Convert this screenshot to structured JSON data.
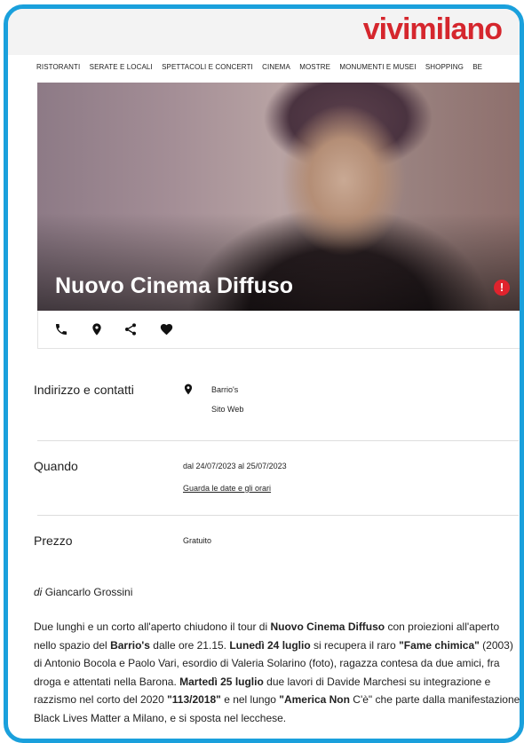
{
  "site": {
    "logo": "vivimilano",
    "accent": "#d5262d",
    "frame_color": "#1aa0dc"
  },
  "nav": {
    "items": [
      "RISTORANTI",
      "SERATE E LOCALI",
      "SPETTACOLI E CONCERTI",
      "CINEMA",
      "MOSTRE",
      "MONUMENTI E MUSEI",
      "SHOPPING",
      "BE"
    ]
  },
  "hero": {
    "title": "Nuovo Cinema Diffuso",
    "alert_symbol": "!"
  },
  "actions": [
    {
      "icon": "phone-icon"
    },
    {
      "icon": "location-pin-icon"
    },
    {
      "icon": "share-icon"
    },
    {
      "icon": "heart-icon"
    }
  ],
  "details": {
    "address": {
      "label": "Indirizzo e contatti",
      "venue": "Barrio's",
      "website": "Sito Web"
    },
    "when": {
      "label": "Quando",
      "range": "dal 24/07/2023 al 25/07/2023",
      "link": "Guarda le date e gli orari"
    },
    "price": {
      "label": "Prezzo",
      "value": "Gratuito"
    }
  },
  "article": {
    "author_prefix": "di",
    "author": "Giancarlo Grossini",
    "segments": [
      {
        "text": "Due lunghi e un corto all'aperto chiudono il tour di ",
        "bold": false
      },
      {
        "text": "Nuovo Cinema Diffuso",
        "bold": true
      },
      {
        "text": " con proiezioni all'aperto nello spazio del ",
        "bold": false
      },
      {
        "text": "Barrio's",
        "bold": true
      },
      {
        "text": " dalle ore 21.15. ",
        "bold": false
      },
      {
        "text": "Lunedì 24 luglio",
        "bold": true
      },
      {
        "text": " si recupera il raro ",
        "bold": false
      },
      {
        "text": "\"Fame chimica\"",
        "bold": true
      },
      {
        "text": " (2003) di Antonio Bocola e Paolo Vari, esordio di Valeria Solarino (foto), ragazza contesa da due amici, fra droga e attentati nella Barona. ",
        "bold": false
      },
      {
        "text": "Martedì 25 luglio",
        "bold": true
      },
      {
        "text": " due lavori di Davide Marchesi su integrazione e razzismo nel corto del 2020 ",
        "bold": false
      },
      {
        "text": "\"113/2018\"",
        "bold": true
      },
      {
        "text": " e nel lungo ",
        "bold": false
      },
      {
        "text": "\"America Non",
        "bold": true
      },
      {
        "text": " C'è\" che parte dalla manifestazione Black Lives Matter a Milano, e si sposta nel lecchese.",
        "bold": false
      }
    ]
  }
}
